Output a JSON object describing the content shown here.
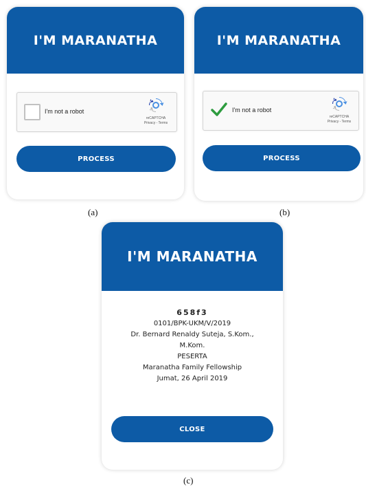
{
  "panels": {
    "a": {
      "header_title": "I'M MARANATHA",
      "recaptcha": {
        "label": "I'm not a robot",
        "brand": "reCAPTCHA",
        "links": "Privacy - Terms",
        "checked": false
      },
      "button_label": "PROCESS",
      "caption": "(a)"
    },
    "b": {
      "header_title": "I'M MARANATHA",
      "recaptcha": {
        "label": "I'm not a robot",
        "brand": "reCAPTCHA",
        "links": "Privacy - Terms",
        "checked": true
      },
      "button_label": "PROCESS",
      "caption": "(b)"
    },
    "c": {
      "header_title": "I'M MARANATHA",
      "details": {
        "code": "658f3",
        "number": "0101/BPK-UKM/V/2019",
        "name_line1": "Dr. Bernard Renaldy Suteja, S.Kom.,",
        "name_line2": "M.Kom.",
        "role": "PESERTA",
        "event": "Maranatha Family Fellowship",
        "date": "Jumat, 26 April 2019"
      },
      "button_label": "CLOSE",
      "caption": "(c)"
    }
  },
  "colors": {
    "brand_blue": "#0d5ba6",
    "check_green": "#2e9c3f"
  }
}
